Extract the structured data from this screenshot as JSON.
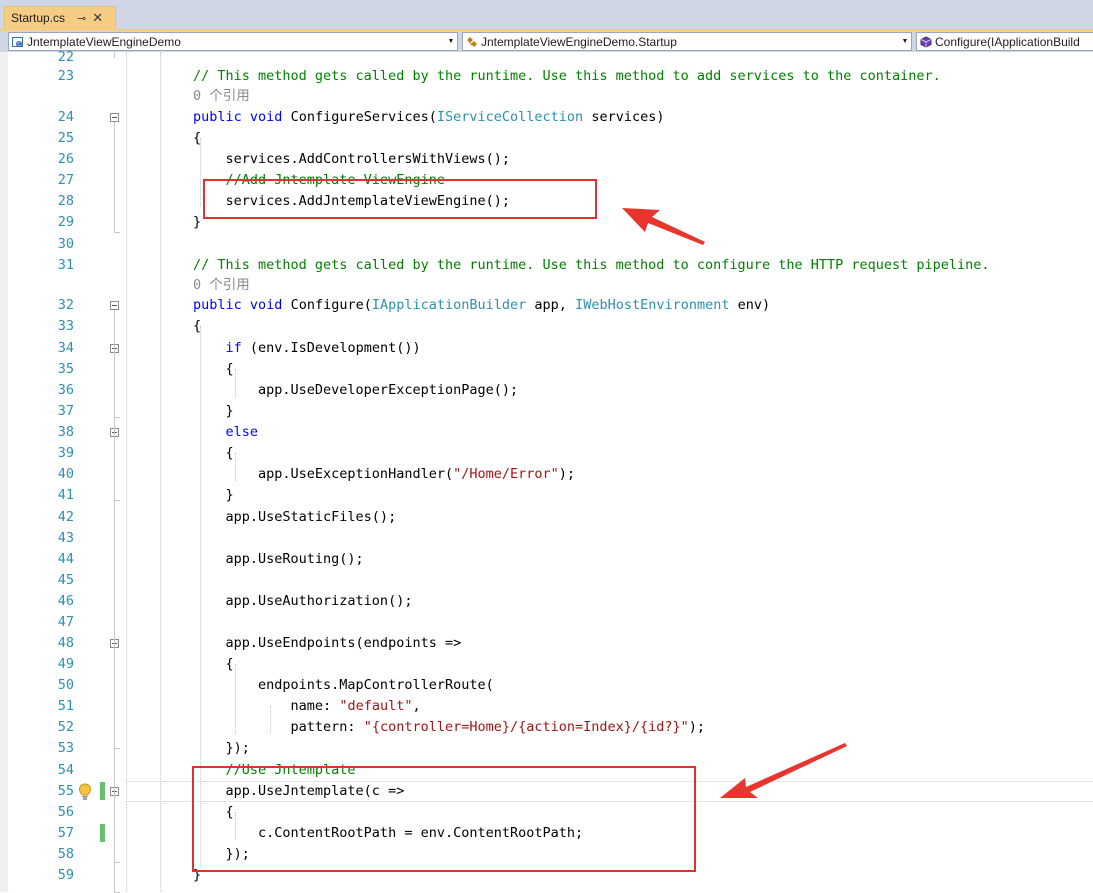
{
  "tab": {
    "filename": "Startup.cs",
    "pin_glyph": "⊸",
    "close_glyph": "✕"
  },
  "nav": {
    "project": "JntemplateViewEngineDemo",
    "class": "JntemplateViewEngineDemo.Startup",
    "member": "Configure(IApplicationBuild"
  },
  "colors": {
    "keyword": "#0000ff",
    "type": "#2b91af",
    "comment": "#008000",
    "string": "#a31515",
    "line_number": "#2b91af",
    "highlight_box": "#e03030",
    "tab_active": "#f5cc84"
  },
  "icons": {
    "lightbulb": "lightbulb-icon",
    "fold": "collapse-box-icon"
  },
  "codelens": {
    "refs": "0 个引用"
  },
  "lines": {
    "l22": [],
    "l23": [
      {
        "t": "// This method gets called by the runtime. Use this method to add services to the container.",
        "c": "cm"
      }
    ],
    "l24": [
      {
        "t": "public",
        "c": "kw"
      },
      {
        "t": " "
      },
      {
        "t": "void",
        "c": "kw"
      },
      {
        "t": " ConfigureServices("
      },
      {
        "t": "IServiceCollection",
        "c": "ty"
      },
      {
        "t": " services)"
      }
    ],
    "l25": [
      {
        "t": "{"
      }
    ],
    "l26": [
      {
        "t": "    services.AddControllersWithViews();"
      }
    ],
    "l27": [
      {
        "t": "    //Add Jntemplate ViewEngine",
        "c": "cm"
      }
    ],
    "l28": [
      {
        "t": "    services.AddJntemplateViewEngine();"
      }
    ],
    "l29": [
      {
        "t": "}"
      }
    ],
    "l30": [],
    "l31": [
      {
        "t": "// This method gets called by the runtime. Use this method to configure the HTTP request pipeline.",
        "c": "cm"
      }
    ],
    "l32": [
      {
        "t": "public",
        "c": "kw"
      },
      {
        "t": " "
      },
      {
        "t": "void",
        "c": "kw"
      },
      {
        "t": " Configure("
      },
      {
        "t": "IApplicationBuilder",
        "c": "ty"
      },
      {
        "t": " app, "
      },
      {
        "t": "IWebHostEnvironment",
        "c": "ty"
      },
      {
        "t": " env)"
      }
    ],
    "l33": [
      {
        "t": "{"
      }
    ],
    "l34": [
      {
        "t": "    "
      },
      {
        "t": "if",
        "c": "kw"
      },
      {
        "t": " (env.IsDevelopment())"
      }
    ],
    "l35": [
      {
        "t": "    {"
      }
    ],
    "l36": [
      {
        "t": "        app.UseDeveloperExceptionPage();"
      }
    ],
    "l37": [
      {
        "t": "    }"
      }
    ],
    "l38": [
      {
        "t": "    "
      },
      {
        "t": "else",
        "c": "kw"
      }
    ],
    "l39": [
      {
        "t": "    {"
      }
    ],
    "l40": [
      {
        "t": "        app.UseExceptionHandler("
      },
      {
        "t": "\"/Home/Error\"",
        "c": "st"
      },
      {
        "t": ");"
      }
    ],
    "l41": [
      {
        "t": "    }"
      }
    ],
    "l42": [
      {
        "t": "    app.UseStaticFiles();"
      }
    ],
    "l43": [],
    "l44": [
      {
        "t": "    app.UseRouting();"
      }
    ],
    "l45": [],
    "l46": [
      {
        "t": "    app.UseAuthorization();"
      }
    ],
    "l47": [],
    "l48": [
      {
        "t": "    app.UseEndpoints(endpoints =>"
      }
    ],
    "l49": [
      {
        "t": "    {"
      }
    ],
    "l50": [
      {
        "t": "        endpoints.MapControllerRoute("
      }
    ],
    "l51": [
      {
        "t": "            name: "
      },
      {
        "t": "\"default\"",
        "c": "st"
      },
      {
        "t": ","
      }
    ],
    "l52": [
      {
        "t": "            pattern: "
      },
      {
        "t": "\"{controller=Home}/{action=Index}/{id?}\"",
        "c": "st"
      },
      {
        "t": ");"
      }
    ],
    "l53": [
      {
        "t": "    });"
      }
    ],
    "l54": [
      {
        "t": "    //Use Jntemplate",
        "c": "cm"
      }
    ],
    "l55": [
      {
        "t": "    app.UseJntemplate(c =>"
      }
    ],
    "l56": [
      {
        "t": "    {"
      }
    ],
    "l57": [
      {
        "t": "        c.ContentRootPath = env.ContentRootPath;"
      }
    ],
    "l58": [
      {
        "t": "    });"
      }
    ],
    "l59": [
      {
        "t": "}"
      }
    ]
  }
}
